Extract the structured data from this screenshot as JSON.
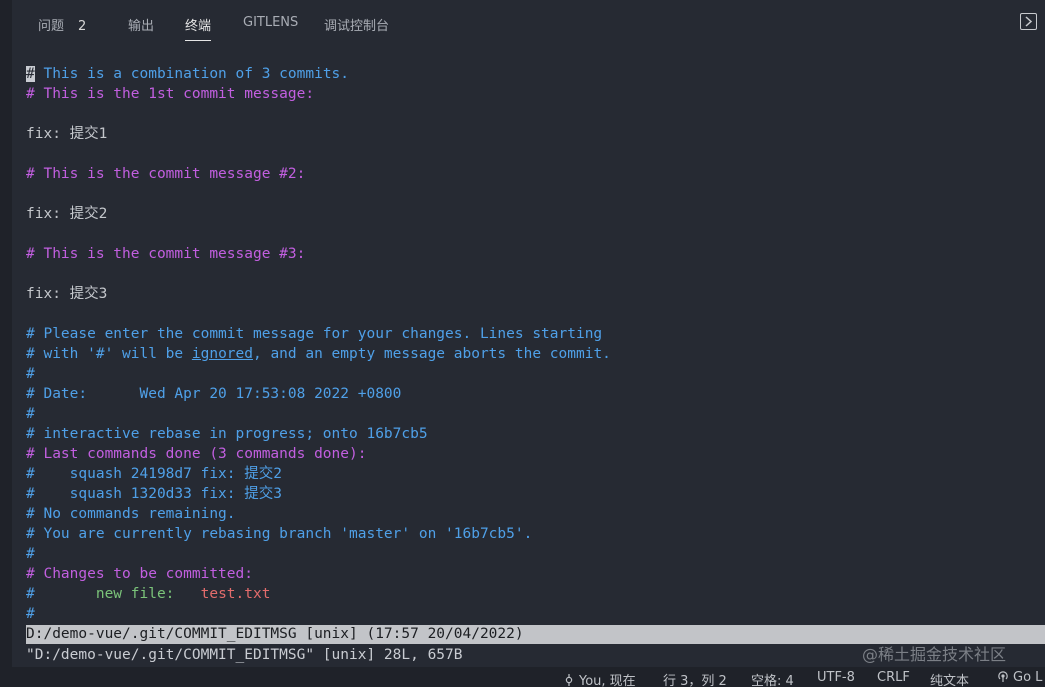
{
  "tabs": [
    {
      "label": "问题",
      "badge": "2"
    },
    {
      "label": "输出"
    },
    {
      "label": "终端",
      "active": true
    },
    {
      "label": "GITLENS"
    },
    {
      "label": "调试控制台"
    }
  ],
  "terminal": {
    "l1_cursor": "#",
    "l1_rest": " This is a combination of 3 commits.",
    "l2": "# This is the 1st commit message:",
    "l4": "fix: 提交1",
    "l6": "# This is the commit message #2:",
    "l8": "fix: 提交2",
    "l10": "# This is the commit message #3:",
    "l12": "fix: 提交3",
    "l14": "# Please enter the commit message for your changes. Lines starting",
    "l15_a": "# with '#' will be ",
    "l15_u": "ignored",
    "l15_b": ", and an empty message aborts the commit.",
    "l16": "#",
    "l17": "# Date:      Wed Apr 20 17:53:08 2022 +0800",
    "l18": "#",
    "l19": "# interactive rebase in progress; onto 16b7cb5",
    "l20": "# Last commands done (3 commands done):",
    "l21": "#    squash 24198d7 fix: 提交2",
    "l22": "#    squash 1320d33 fix: 提交3",
    "l23": "# No commands remaining.",
    "l24": "# You are currently rebasing branch 'master' on '16b7cb5'.",
    "l25": "#",
    "l26": "# Changes to be committed:",
    "l27_hash": "#",
    "l27_label": "       new file:",
    "l27_file": "   test.txt",
    "l28": "#"
  },
  "statusline": "D:/demo-vue/.git/COMMIT_EDITMSG [unix] (17:57 20/04/2022)",
  "msgline": "\"D:/demo-vue/.git/COMMIT_EDITMSG\" [unix] 28L, 657B",
  "watermark": "@稀土掘金技术社区",
  "statusbar": {
    "blame": "You, 现在",
    "position": "行 3，列 2",
    "indent": "空格: 4",
    "encoding": "UTF-8",
    "eol": "CRLF",
    "language": "纯文本",
    "golive": "Go L"
  },
  "icons": {
    "maximize": "panel-maximize-icon",
    "blame": "git-commit-icon",
    "golive": "broadcast-icon"
  },
  "colors": {
    "comment_blue": "#4fa0e8",
    "comment_magenta": "#c25fe0",
    "new_file_green": "#7bc47a",
    "file_red": "#e36c6c",
    "background": "#262a33"
  }
}
